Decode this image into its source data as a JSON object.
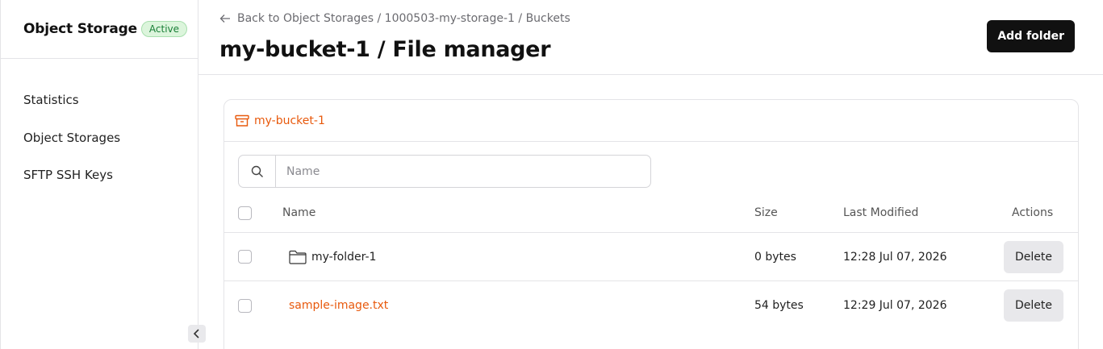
{
  "sidebar": {
    "brand": "Object Storage",
    "status_badge": "Active",
    "items": [
      {
        "label": "Statistics"
      },
      {
        "label": "Object Storages"
      },
      {
        "label": "SFTP SSH Keys"
      }
    ],
    "collapse_icon": "chevron-left-icon"
  },
  "header": {
    "breadcrumb": "Back to Object Storages / 1000503-my-storage-1 / Buckets",
    "title": "my-bucket-1 / File manager",
    "add_folder_label": "Add folder"
  },
  "bucket": {
    "name": "my-bucket-1",
    "icon": "archive-box-icon"
  },
  "search": {
    "placeholder": "Name",
    "value": ""
  },
  "table": {
    "columns": [
      "Name",
      "Size",
      "Last Modified",
      "Actions"
    ],
    "rows": [
      {
        "type": "folder",
        "name": "my-folder-1",
        "size": "0 bytes",
        "modified": "12:28 Jul 07, 2026",
        "action": "Delete"
      },
      {
        "type": "file",
        "name": "sample-image.txt",
        "size": "54 bytes",
        "modified": "12:29 Jul 07, 2026",
        "action": "Delete"
      }
    ]
  },
  "colors": {
    "accent": "#e8590c",
    "primary_button": "#111111",
    "badge_bg": "#dcf5dc",
    "badge_text": "#1a7f37"
  }
}
